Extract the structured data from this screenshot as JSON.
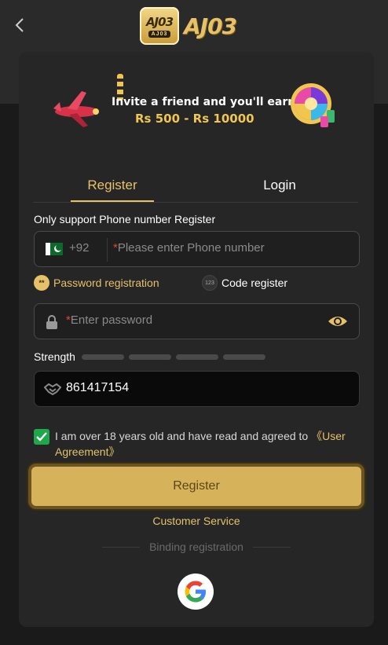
{
  "header": {
    "logo_badge_text": "AJ03",
    "logo_badge_sub": "AJ03",
    "logo_wordmark": "AJ03"
  },
  "banner": {
    "line1": "Invite a friend and you'll earn",
    "line2": "Rs 500 - Rs 10000"
  },
  "tabs": [
    {
      "label": "Register",
      "active": true
    },
    {
      "label": "Login",
      "active": false
    }
  ],
  "form": {
    "support_label": "Only support Phone number Register",
    "country_code": "+92",
    "phone_placeholder": "Please enter Phone number",
    "modes": [
      {
        "label": "Password registration",
        "icon_text": "**",
        "active": true
      },
      {
        "label": "Code register",
        "icon_text": "123",
        "active": false
      }
    ],
    "password_placeholder": "Enter password",
    "strength_label": "Strength",
    "invite_code": "861417154",
    "agree_text": "I am over 18 years old and have read and agreed to ",
    "agree_link": "《User Agreement》",
    "agreed": true,
    "register_label": "Register",
    "customer_service": "Customer Service",
    "binding_label": "Binding registration"
  },
  "colors": {
    "accent": "#e6c16a",
    "button": "#d6b35a",
    "checkbox": "#1ea84a",
    "card": "#262626"
  },
  "icons": [
    "back-chevron-icon",
    "pakistan-flag-icon",
    "lock-icon",
    "eye-icon",
    "handshake-icon",
    "check-icon",
    "google-icon"
  ]
}
